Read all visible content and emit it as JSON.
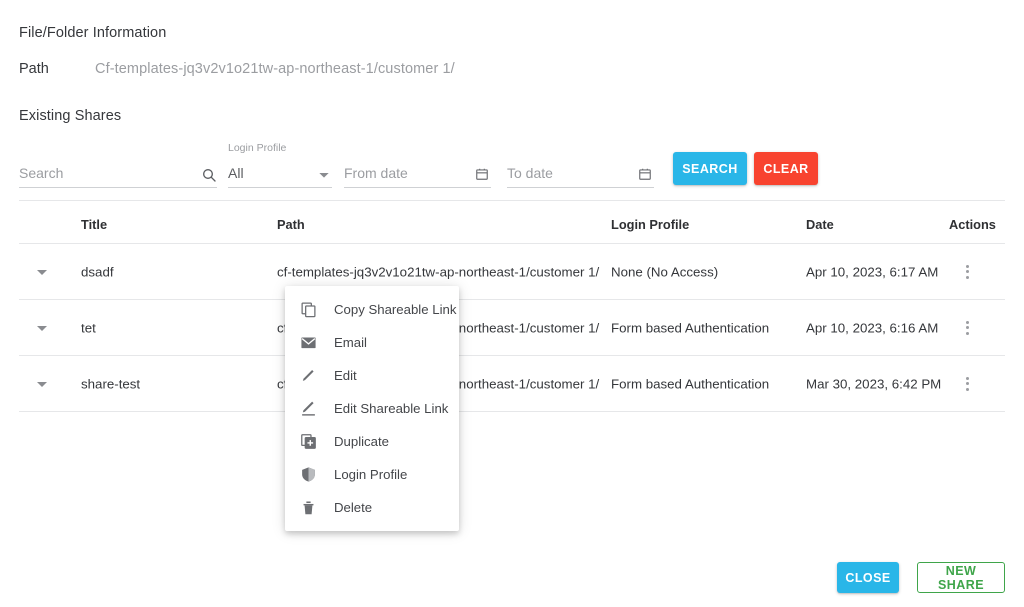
{
  "header": {
    "file_folder_information": "File/Folder Information",
    "path_label": "Path",
    "path_value": "Cf-templates-jq3v2v1o21tw-ap-northeast-1/customer 1/",
    "existing_shares": "Existing Shares"
  },
  "filters": {
    "search_placeholder": "Search",
    "search_value": "",
    "login_profile_label": "Login Profile",
    "login_profile_value": "All",
    "from_date_placeholder": "From date",
    "from_date_value": "",
    "to_date_placeholder": "To date",
    "to_date_value": "",
    "search_button": "SEARCH",
    "clear_button": "CLEAR",
    "search_button_color": "#29b6e8",
    "clear_button_color": "#f8432f",
    "icons": {
      "search": "search-icon",
      "calendar": "calendar-icon",
      "dropdown": "chevron-down-icon"
    }
  },
  "table": {
    "columns": [
      "Title",
      "Path",
      "Login Profile",
      "Date",
      "Actions"
    ],
    "rows": [
      {
        "title": "dsadf",
        "path": "cf-templates-jq3v2v1o21tw-ap-northeast-1/customer 1/",
        "login_profile": "None (No Access)",
        "date": "Apr 10, 2023, 6:17 AM"
      },
      {
        "title": "tet",
        "path": "cf-templates-jq3v2v1o21tw-ap-northeast-1/customer 1/",
        "login_profile": "Form based Authentication",
        "date": "Apr 10, 2023, 6:16 AM"
      },
      {
        "title": "share-test",
        "path": "cf-templates-jq3v2v1o21tw-ap-northeast-1/customer 1/",
        "login_profile": "Form based Authentication",
        "date": "Mar 30, 2023, 6:42 PM"
      }
    ]
  },
  "context_menu": {
    "items": [
      {
        "label": "Copy Shareable Link",
        "icon": "copy-icon"
      },
      {
        "label": "Email",
        "icon": "email-icon"
      },
      {
        "label": "Edit",
        "icon": "pencil-icon"
      },
      {
        "label": "Edit Shareable Link",
        "icon": "pencil-underline-icon"
      },
      {
        "label": "Duplicate",
        "icon": "duplicate-icon"
      },
      {
        "label": "Login Profile",
        "icon": "shield-icon"
      },
      {
        "label": "Delete",
        "icon": "trash-icon"
      }
    ]
  },
  "footer": {
    "close_button": "CLOSE",
    "new_share_button": "NEW SHARE",
    "close_color": "#29b6e8",
    "new_share_color": "#3fa54a"
  }
}
